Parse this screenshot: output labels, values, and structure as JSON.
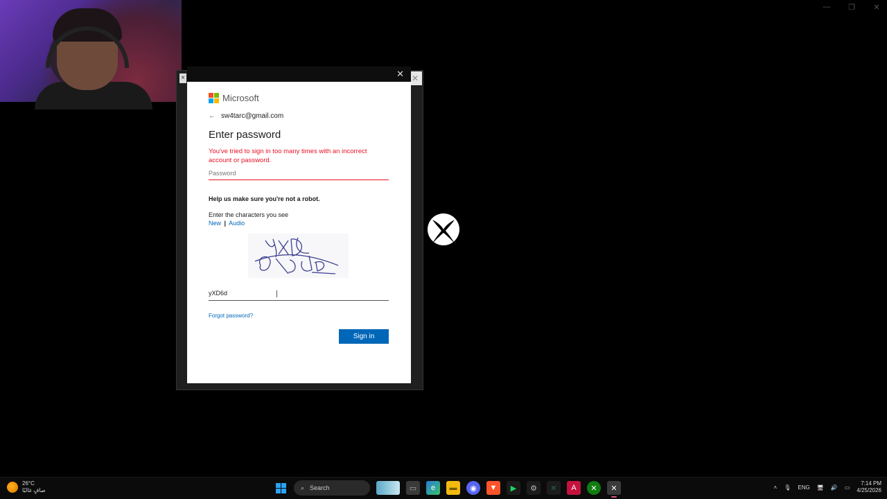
{
  "brand": {
    "name": "Microsoft",
    "colors": [
      "#f25022",
      "#7fba00",
      "#00a4ef",
      "#ffb900"
    ]
  },
  "dialog": {
    "email": "sw4tarc@gmail.com",
    "title": "Enter password",
    "error": "You've tried to sign in too many times with an incorrect account or password.",
    "password_placeholder": "Password",
    "robot_heading": "Help us make sure you're not a robot.",
    "chars_prompt": "Enter the characters you see",
    "link_new": "New",
    "link_sep": "|",
    "link_audio": "Audio",
    "captcha_input_value": "yXD6d",
    "forgot_password": "Forgot password?",
    "signin_label": "Sign in",
    "accent": "#0067b8",
    "error_color": "#e81123"
  },
  "taskbar": {
    "weather_temp": "26°C",
    "weather_desc": "صافٍ غالبًا",
    "search_label": "Search",
    "language": "ENG",
    "time": "7:14 PM",
    "date": "4/25/2026"
  }
}
